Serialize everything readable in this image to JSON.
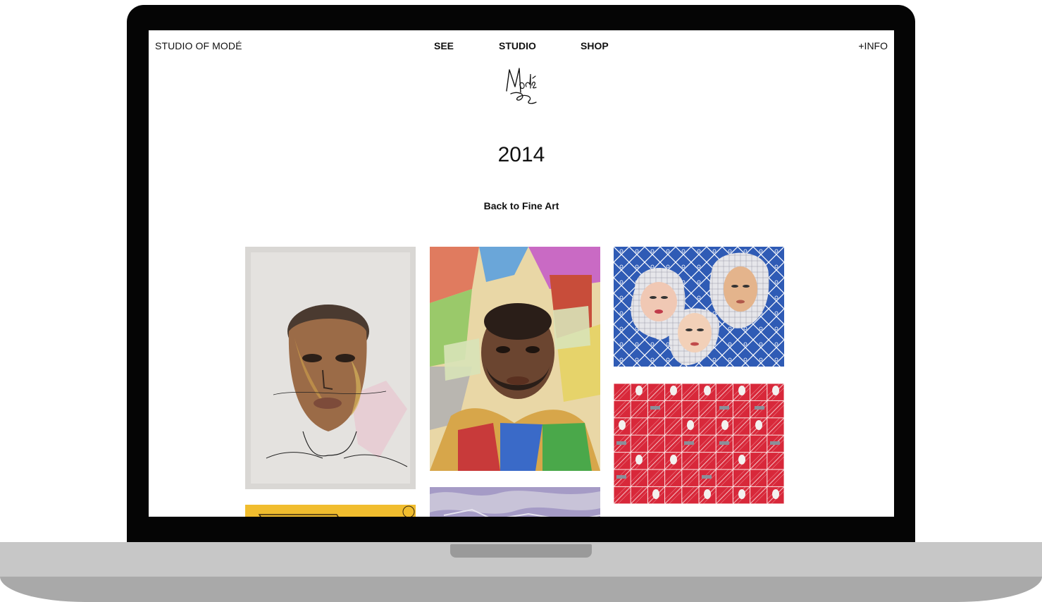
{
  "header": {
    "brand": "STUDIO OF MODÉ",
    "nav": {
      "see": "SEE",
      "studio": "STUDIO",
      "shop": "SHOP",
      "info": "+INFO"
    }
  },
  "logo": {
    "text": "Modé"
  },
  "page": {
    "title": "2014",
    "back_link": "Back to Fine Art"
  },
  "gallery": {
    "icons": [
      "portrait-woman-artwork",
      "portrait-man-artwork",
      "three-faces-pattern-artwork",
      "red-pattern-artwork",
      "yellow-artwork",
      "purple-artwork"
    ]
  },
  "colors": {
    "bezel": "#050505",
    "laptop_base": "#c7c7c7",
    "text": "#111111"
  }
}
